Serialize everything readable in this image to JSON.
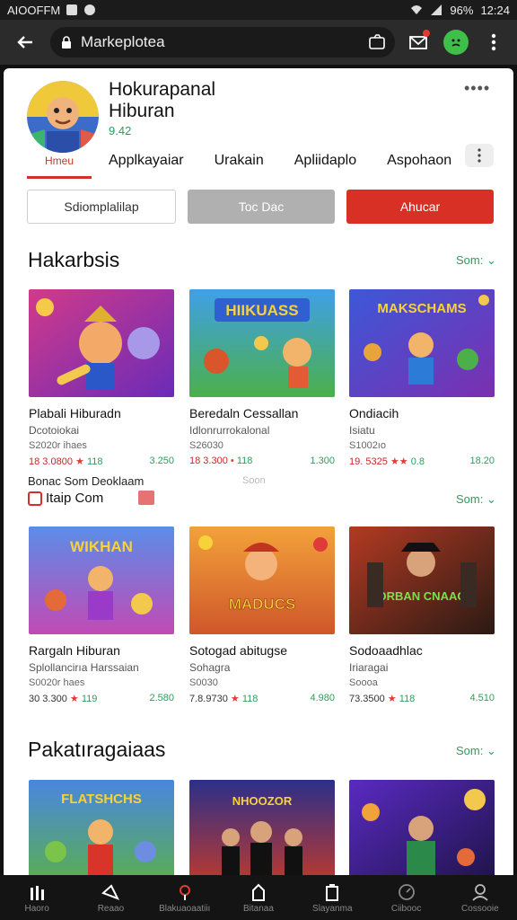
{
  "status_bar": {
    "left_text": "AIOOFFM",
    "right_text": "96%",
    "time": "12:24"
  },
  "browser": {
    "url_text": "Markeplotea"
  },
  "header": {
    "title_line1": "Hokurapanal",
    "title_line2": "Hiburan",
    "subtitle": "9.42",
    "profile_caption": "Hmeu",
    "more": "••••"
  },
  "tabs": [
    "Applkayaiar",
    "Urakain",
    "Apliidaplo",
    "Aspohaon"
  ],
  "buttons": {
    "outline": "Sdiomplalilap",
    "grey": "Toc Dac",
    "red": "Ahucar"
  },
  "sections": [
    {
      "title": "Hakarbsis",
      "see_more": "Som: ⌄"
    },
    {
      "title": "",
      "see_more": "Som: ⌄"
    },
    {
      "title": "Pakatıragaiaas",
      "see_more": "Som: ⌄"
    }
  ],
  "row1": [
    {
      "title": "Plabali Hiburadn",
      "sub": "Dcotoiokai",
      "size": "S2020r ihaes",
      "stat_a": "18 3.0800",
      "star": "★",
      "stat_m": "118",
      "stat_b": "3.250"
    },
    {
      "title": "Beredaln Cessallan",
      "sub": "Idlonrurrokalonal",
      "size": "S26030",
      "stat_a": "18 3.300",
      "star": "•",
      "stat_m": "118",
      "stat_b": "1.300"
    },
    {
      "title": "Ondiacih",
      "sub": "Isiatu",
      "size": "S1002ıo",
      "stat_a": "19. 5325",
      "star": "★★",
      "stat_m": "0.8",
      "stat_b": "18.20"
    }
  ],
  "row2": [
    {
      "title": "Rargaln Hiburan",
      "sub": "Splollancirıa Harssaian",
      "size": "S0020r haes",
      "stat_a": "30 3.300",
      "star": "★",
      "stat_m": "119",
      "stat_b": "2.580"
    },
    {
      "title": "Sotogad abitugse",
      "sub": "Sohagra",
      "size": "S0030",
      "stat_a": "7.8.9730",
      "star": "★",
      "stat_m": "118",
      "stat_b": "4.980"
    },
    {
      "title": "Sodoaadhlac",
      "sub": "Iriaragai",
      "size": "Soooa",
      "stat_a": "73.3500",
      "star": "★",
      "stat_m": "118",
      "stat_b": "4.510"
    }
  ],
  "thumb_text": [
    "",
    "HIIKUASS",
    "MAKSCHAMS",
    "WIKHAN",
    "MADUCS",
    "SORBAN CNAAGE",
    "FLATSHCHS",
    "NHOOZOR",
    ""
  ],
  "promo": {
    "line1": "Bonac Som Deoklaam",
    "line2": "Itaip Com",
    "faded": "Soon"
  },
  "bottom_nav": [
    {
      "label": "Haoro",
      "icon": "home-icon"
    },
    {
      "label": "Reaao",
      "icon": "triangle-icon"
    },
    {
      "label": "Blakuaoaatiiı",
      "icon": "pin-icon"
    },
    {
      "label": "Bitanaa",
      "icon": "bag-icon"
    },
    {
      "label": "Slayanma",
      "icon": "clipboard-icon"
    },
    {
      "label": "Ciibooc",
      "icon": "clock-icon"
    },
    {
      "label": "Cossooie",
      "icon": "user-icon"
    }
  ]
}
